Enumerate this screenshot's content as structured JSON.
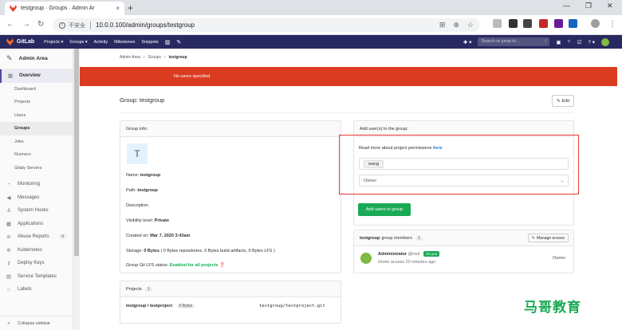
{
  "browser": {
    "tab_title": "testgroup · Groups · Admin Ar",
    "tab_close": "×",
    "new_tab": "+",
    "insecure_label": "不安全",
    "url": "10.0.0.100/admin/groups/testgroup",
    "win_min": "—",
    "win_max": "❐",
    "win_close": "✕"
  },
  "header": {
    "brand": "GitLab",
    "nav": [
      "Projects ▾",
      "Groups ▾",
      "Activity",
      "Milestones",
      "Snippets"
    ],
    "search_placeholder": "Search or jump to...",
    "search_shortcut": "/",
    "plus_label": "✚ ▾",
    "help_label": "? ▾"
  },
  "sidebar": {
    "title": "Admin Area",
    "overview": "Overview",
    "sub_items": [
      "Dashboard",
      "Projects",
      "Users",
      "Groups",
      "Jobs",
      "Runners",
      "Gitaly Servers"
    ],
    "active_sub": "Groups",
    "items": [
      {
        "label": "Monitoring",
        "icon": "monitor-icon"
      },
      {
        "label": "Messages",
        "icon": "megaphone-icon"
      },
      {
        "label": "System Hooks",
        "icon": "hook-icon"
      },
      {
        "label": "Applications",
        "icon": "applications-icon"
      },
      {
        "label": "Abuse Reports",
        "icon": "abuse-icon",
        "count": "0"
      },
      {
        "label": "Kubernetes",
        "icon": "kubernetes-icon"
      },
      {
        "label": "Deploy Keys",
        "icon": "key-icon"
      },
      {
        "label": "Service Templates",
        "icon": "template-icon"
      },
      {
        "label": "Labels",
        "icon": "label-icon"
      }
    ],
    "collapse": "Collapse sidebar"
  },
  "breadcrumb": {
    "admin": "Admin Area",
    "groups": "Groups",
    "current": "testgroup",
    "sep": "›"
  },
  "flash": {
    "message": "No users specified."
  },
  "page": {
    "title": "Group: testgroup",
    "edit_label": "Edit"
  },
  "group_info": {
    "heading": "Group info:",
    "avatar_letter": "T",
    "name_label": "Name:",
    "name_value": "testgroup",
    "path_label": "Path:",
    "path_value": "testgroup",
    "description_label": "Description:",
    "visibility_label": "Visibility level:",
    "visibility_value": "Private",
    "created_label": "Created on:",
    "created_value": "Mar 7, 2020 3:43am",
    "storage_label": "Storage:",
    "storage_value": "0 Bytes",
    "storage_detail": "( 0 Bytes repositories, 0 Bytes build artifacts, 0 Bytes LFS )",
    "lfs_label": "Group Git LFS status:",
    "lfs_value": "Enabled for all projects"
  },
  "projects": {
    "heading": "Projects",
    "count": "1",
    "items": [
      {
        "name": "testgroup / testproject",
        "size": "0 Bytes",
        "path": "testgroup/testproject.git"
      }
    ]
  },
  "add_users": {
    "heading": "Add user(s) to the group:",
    "permissions_text": "Read more about project permissions",
    "permissions_link": "here",
    "user_token": "wang",
    "role_value": "Owner",
    "submit_label": "Add users to group"
  },
  "members": {
    "group": "testgroup",
    "heading_suffix": "group members",
    "count": "1",
    "manage_label": "Manage access",
    "items": [
      {
        "name": "Administrator",
        "username": "@root",
        "you_badge": "It's you",
        "access": "Given access 20 minutes ago",
        "role": "Owner"
      }
    ]
  },
  "watermark": "马哥教育"
}
